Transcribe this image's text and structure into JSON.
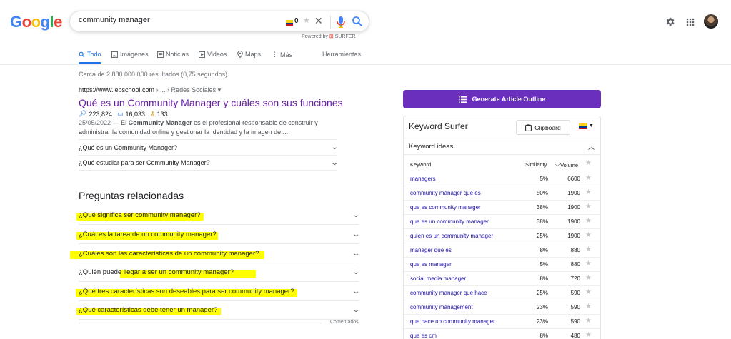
{
  "logo": {
    "letters": [
      "G",
      "o",
      "o",
      "g",
      "l",
      "e"
    ],
    "colors": [
      "#4285f4",
      "#ea4335",
      "#fbbc05",
      "#4285f4",
      "#34a853",
      "#ea4335"
    ]
  },
  "search": {
    "query": "community manager",
    "surfer_count": "0"
  },
  "powered": {
    "prefix": "Powered by",
    "brand": "SURFER"
  },
  "tabs": [
    {
      "label": "Todo",
      "icon": "search-icon"
    },
    {
      "label": "Imágenes",
      "icon": "image-icon"
    },
    {
      "label": "Noticias",
      "icon": "news-icon"
    },
    {
      "label": "Videos",
      "icon": "video-icon"
    },
    {
      "label": "Maps",
      "icon": "map-pin-icon"
    },
    {
      "label": "Más",
      "icon": "more-icon"
    }
  ],
  "tools": "Herramientas",
  "stats": "Cerca de 2.880.000.000 resultados (0,75 segundos)",
  "result": {
    "url": "https://www.iebschool.com",
    "breadcrumb": "› ... › Redes Sociales",
    "title": "Qué es un Community Manager y cuáles son sus funciones",
    "metric1": "223,824",
    "metric2": "16,033",
    "metric3": "133",
    "date": "25/05/2022 —",
    "snippet_a": "El",
    "snippet_bold": "Community Manager",
    "snippet_b": "es el profesional responsable de construir y administrar la comunidad online y gestionar la identidad y la imagen de ...",
    "sub_questions": [
      "¿Qué es un Community Manager?",
      "¿Qué estudiar para ser Community Manager?"
    ]
  },
  "paa": {
    "heading": "Preguntas relacionadas",
    "questions": [
      "¿Qué significa ser community manager?",
      "¿Cuál es la tarea de un community manager?",
      "¿Cuáles son las características de un community manager?",
      "¿Quién puede llegar a ser un community manager?",
      "¿Qué tres características son deseables para ser community manager?",
      "¿Qué características debe tener un manager?"
    ],
    "comments": "Comentarios"
  },
  "surfer": {
    "generate_label": "Generate Article Outline",
    "panel_title": "Keyword Surfer",
    "clipboard_label": "Clipboard",
    "ideas_title": "Keyword ideas",
    "headers": {
      "keyword": "Keyword",
      "similarity": "Similarity",
      "volume": "Volume"
    },
    "rows": [
      {
        "keyword": "managers",
        "similarity": "5%",
        "volume": "6600"
      },
      {
        "keyword": "community manager que es",
        "similarity": "50%",
        "volume": "1900"
      },
      {
        "keyword": "que es community manager",
        "similarity": "38%",
        "volume": "1900"
      },
      {
        "keyword": "que es un community manager",
        "similarity": "38%",
        "volume": "1900"
      },
      {
        "keyword": "quien es un community manager",
        "similarity": "25%",
        "volume": "1900"
      },
      {
        "keyword": "manager que es",
        "similarity": "8%",
        "volume": "880"
      },
      {
        "keyword": "que es manager",
        "similarity": "5%",
        "volume": "880"
      },
      {
        "keyword": "social media manager",
        "similarity": "8%",
        "volume": "720"
      },
      {
        "keyword": "community manager que hace",
        "similarity": "25%",
        "volume": "590"
      },
      {
        "keyword": "community management",
        "similarity": "23%",
        "volume": "590"
      },
      {
        "keyword": "que hace un community manager",
        "similarity": "23%",
        "volume": "590"
      },
      {
        "keyword": "que es cm",
        "similarity": "8%",
        "volume": "480"
      }
    ]
  },
  "colors": {
    "link_blue": "#1a0dab",
    "visited": "#681da8",
    "surfer_purple": "#6b2fbd",
    "highlight": "#ffff00"
  }
}
